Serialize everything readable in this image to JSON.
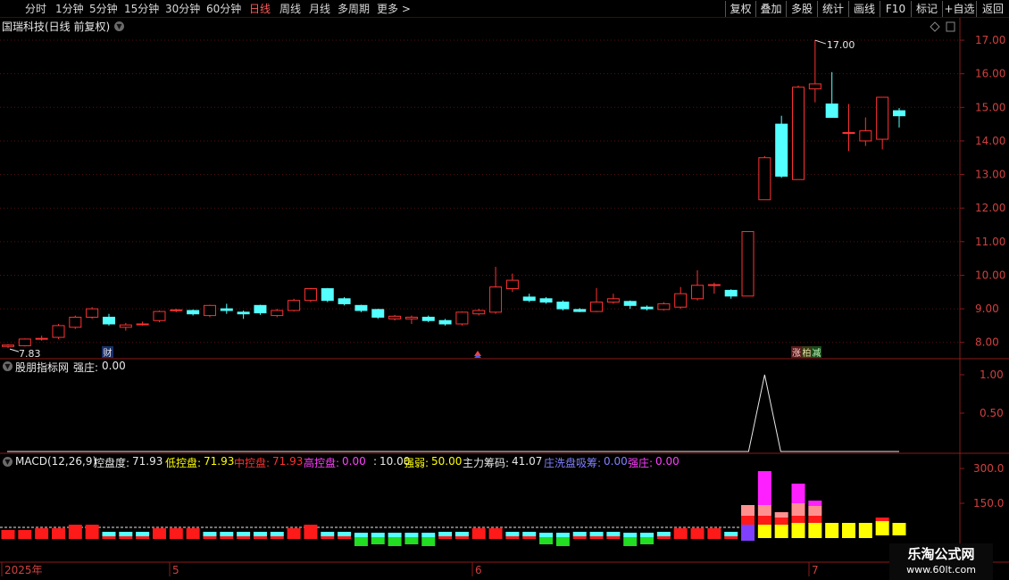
{
  "toolbar": {
    "periods": [
      "分时",
      "1分钟",
      "5分钟",
      "15分钟",
      "30分钟",
      "60分钟",
      "日线",
      "周线",
      "月线",
      "多周期",
      "更多 >"
    ],
    "active_period": "日线",
    "right_buttons": [
      "复权",
      "叠加",
      "多股",
      "统计",
      "画线",
      "F10",
      "标记",
      "+自选",
      "返回"
    ]
  },
  "main": {
    "title": "国瑞科技(日线 前复权)",
    "y_ticks": [
      "17.00",
      "16.00",
      "15.00",
      "14.00",
      "13.00",
      "12.00",
      "11.00",
      "10.00",
      "9.00",
      "8.00"
    ],
    "high_label": "17.00",
    "low_label": "7.83",
    "markers": {
      "cai": "财",
      "zhang": "涨",
      "pai": "柏",
      "jian": "减"
    }
  },
  "sub1": {
    "title": "股朋指标网",
    "metric_label": "强庄:",
    "metric_value": "0.00",
    "y_ticks": [
      "1.00",
      "0.50"
    ]
  },
  "sub2": {
    "macd_label": "MACD(12,26,9)",
    "items": [
      {
        "label": "控盘度:",
        "value": "71.93",
        "color": "#e8e8e8"
      },
      {
        "label": "低控盘:",
        "value": "71.93",
        "color": "#ffff00"
      },
      {
        "label": "中控盘:",
        "value": "71.93",
        "color": "#ff3030"
      },
      {
        "label": "高控盘:",
        "value": "0.00",
        "color": "#ff40ff"
      },
      {
        "label": ":",
        "value": "10.00",
        "color": "#e8e8e8"
      },
      {
        "label": "强弱:",
        "value": "50.00",
        "color": "#ffff00"
      },
      {
        "label": "主力筹码:",
        "value": "41.07",
        "color": "#e8e8e8"
      },
      {
        "label": "庄洗盘吸筹:",
        "value": "0.00",
        "color": "#8080ff"
      },
      {
        "label": "强庄:",
        "value": "0.00",
        "color": "#ff40ff"
      }
    ],
    "y_ticks": [
      "300.0",
      "150.0"
    ]
  },
  "date_axis": {
    "labels": [
      "2025年",
      "5",
      "6",
      "7"
    ]
  },
  "watermark": {
    "line1": "乐淘公式网",
    "line2": "www.60lt.com"
  },
  "colors": {
    "up": "#ff3232",
    "down": "#54ffff",
    "axis": "#8b1a1a",
    "text": "#c8c8c8"
  },
  "chart_data": {
    "type": "candlestick",
    "ylim": [
      7.7,
      17.4
    ],
    "candles": [
      {
        "o": 7.88,
        "c": 7.92,
        "h": 7.95,
        "l": 7.83
      },
      {
        "o": 7.9,
        "c": 8.1,
        "h": 8.12,
        "l": 7.88
      },
      {
        "o": 8.1,
        "c": 8.12,
        "h": 8.2,
        "l": 8.05
      },
      {
        "o": 8.15,
        "c": 8.5,
        "h": 8.55,
        "l": 8.1
      },
      {
        "o": 8.45,
        "c": 8.75,
        "h": 8.8,
        "l": 8.4
      },
      {
        "o": 8.75,
        "c": 9.0,
        "h": 9.05,
        "l": 8.7
      },
      {
        "o": 8.75,
        "c": 8.55,
        "h": 8.85,
        "l": 8.5
      },
      {
        "o": 8.45,
        "c": 8.52,
        "h": 8.58,
        "l": 8.35
      },
      {
        "o": 8.55,
        "c": 8.55,
        "h": 8.62,
        "l": 8.5
      },
      {
        "o": 8.65,
        "c": 8.92,
        "h": 8.95,
        "l": 8.6
      },
      {
        "o": 8.95,
        "c": 8.97,
        "h": 9.0,
        "l": 8.9
      },
      {
        "o": 8.95,
        "c": 8.85,
        "h": 8.98,
        "l": 8.8
      },
      {
        "o": 8.8,
        "c": 9.1,
        "h": 9.12,
        "l": 8.75
      },
      {
        "o": 9.0,
        "c": 8.95,
        "h": 9.15,
        "l": 8.85
      },
      {
        "o": 8.9,
        "c": 8.85,
        "h": 8.95,
        "l": 8.7
      },
      {
        "o": 9.1,
        "c": 8.88,
        "h": 9.12,
        "l": 8.82
      },
      {
        "o": 8.8,
        "c": 8.95,
        "h": 9.0,
        "l": 8.75
      },
      {
        "o": 8.95,
        "c": 9.25,
        "h": 9.3,
        "l": 8.92
      },
      {
        "o": 9.25,
        "c": 9.6,
        "h": 9.62,
        "l": 9.2
      },
      {
        "o": 9.6,
        "c": 9.25,
        "h": 9.62,
        "l": 9.2
      },
      {
        "o": 9.3,
        "c": 9.15,
        "h": 9.35,
        "l": 9.1
      },
      {
        "o": 9.1,
        "c": 8.95,
        "h": 9.12,
        "l": 8.9
      },
      {
        "o": 8.98,
        "c": 8.75,
        "h": 9.0,
        "l": 8.7
      },
      {
        "o": 8.7,
        "c": 8.78,
        "h": 8.82,
        "l": 8.65
      },
      {
        "o": 8.7,
        "c": 8.75,
        "h": 8.8,
        "l": 8.55
      },
      {
        "o": 8.75,
        "c": 8.65,
        "h": 8.8,
        "l": 8.6
      },
      {
        "o": 8.65,
        "c": 8.55,
        "h": 8.7,
        "l": 8.5
      },
      {
        "o": 8.55,
        "c": 8.9,
        "h": 8.92,
        "l": 8.5
      },
      {
        "o": 8.85,
        "c": 8.95,
        "h": 9.0,
        "l": 8.8
      },
      {
        "o": 8.9,
        "c": 9.65,
        "h": 10.25,
        "l": 8.85
      },
      {
        "o": 9.6,
        "c": 9.85,
        "h": 10.05,
        "l": 9.5
      },
      {
        "o": 9.35,
        "c": 9.25,
        "h": 9.45,
        "l": 9.2
      },
      {
        "o": 9.3,
        "c": 9.2,
        "h": 9.35,
        "l": 9.15
      },
      {
        "o": 9.2,
        "c": 9.0,
        "h": 9.25,
        "l": 8.95
      },
      {
        "o": 8.98,
        "c": 8.92,
        "h": 9.02,
        "l": 8.9
      },
      {
        "o": 8.92,
        "c": 9.2,
        "h": 9.62,
        "l": 8.9
      },
      {
        "o": 9.2,
        "c": 9.3,
        "h": 9.45,
        "l": 9.15
      },
      {
        "o": 9.22,
        "c": 9.1,
        "h": 9.25,
        "l": 9.0
      },
      {
        "o": 9.05,
        "c": 9.0,
        "h": 9.1,
        "l": 8.95
      },
      {
        "o": 8.98,
        "c": 9.15,
        "h": 9.2,
        "l": 8.95
      },
      {
        "o": 9.05,
        "c": 9.45,
        "h": 9.65,
        "l": 9.0
      },
      {
        "o": 9.3,
        "c": 9.7,
        "h": 10.15,
        "l": 9.25
      },
      {
        "o": 9.7,
        "c": 9.72,
        "h": 9.78,
        "l": 9.45
      },
      {
        "o": 9.55,
        "c": 9.38,
        "h": 9.58,
        "l": 9.3
      },
      {
        "o": 9.38,
        "c": 11.3,
        "h": 11.3,
        "l": 9.38
      },
      {
        "o": 12.25,
        "c": 13.5,
        "h": 13.55,
        "l": 12.25
      },
      {
        "o": 14.5,
        "c": 12.95,
        "h": 14.75,
        "l": 12.9
      },
      {
        "o": 12.85,
        "c": 15.6,
        "h": 15.65,
        "l": 12.85
      },
      {
        "o": 15.55,
        "c": 15.7,
        "h": 17.0,
        "l": 15.15
      },
      {
        "o": 15.1,
        "c": 14.7,
        "h": 16.05,
        "l": 14.7
      },
      {
        "o": 14.25,
        "c": 14.25,
        "h": 15.1,
        "l": 13.7
      },
      {
        "o": 14.0,
        "c": 14.3,
        "h": 14.7,
        "l": 13.85
      },
      {
        "o": 14.05,
        "c": 15.3,
        "h": 15.3,
        "l": 13.75
      },
      {
        "o": 14.9,
        "c": 14.75,
        "h": 14.98,
        "l": 14.4
      }
    ]
  }
}
